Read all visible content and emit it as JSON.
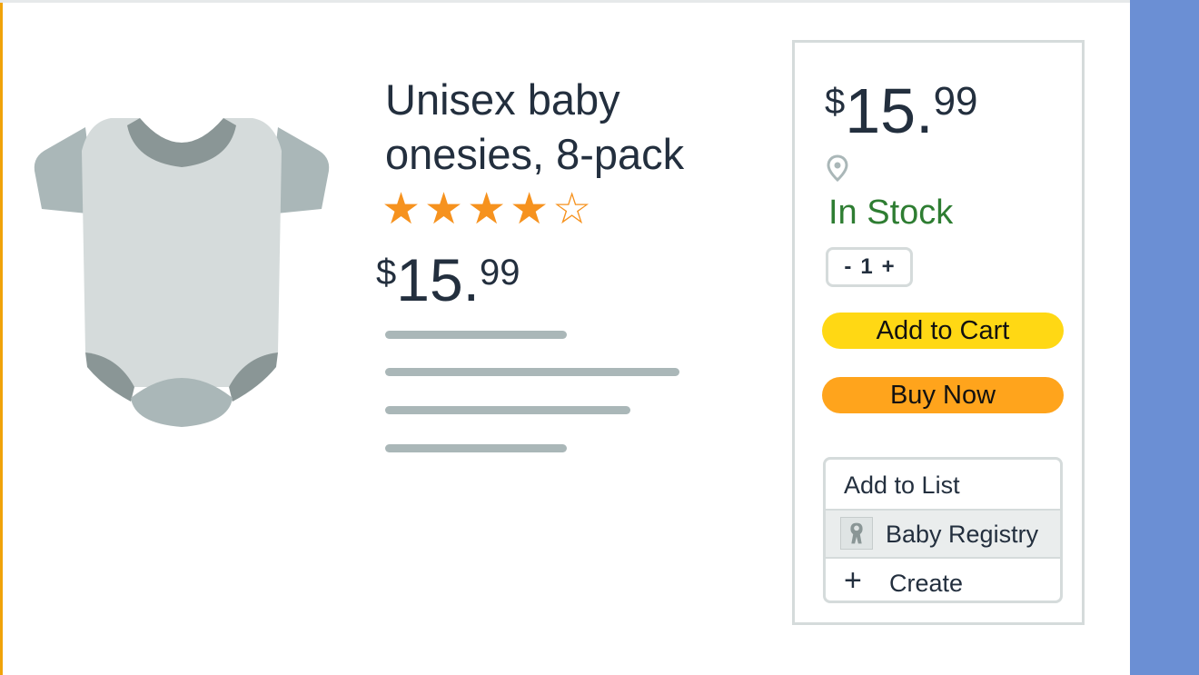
{
  "product": {
    "title_line1": "Unisex baby",
    "title_line2": "onesies, 8-pack",
    "rating": {
      "filled": 4,
      "total": 5
    },
    "price": {
      "currency": "$",
      "whole": "15.",
      "fraction": "99"
    },
    "image_icon": "baby-onesie-icon"
  },
  "buy_box": {
    "price": {
      "currency": "$",
      "whole": "15.",
      "fraction": "99"
    },
    "location_icon": "map-pin-icon",
    "stock_status": "In Stock",
    "quantity": {
      "minus": "-",
      "value": "1",
      "plus": "+"
    },
    "add_to_cart": "Add to Cart",
    "buy_now": "Buy Now",
    "list_menu": {
      "header": "Add to List",
      "registry_label": "Baby Registry",
      "create_label": "Create",
      "create_icon": "+"
    }
  },
  "colors": {
    "accent_orange": "#ffa41c",
    "cart_yellow": "#ffd814",
    "stock_green": "#2e7d32",
    "star_orange": "#f6921e",
    "side_band_blue": "#6b8fd4"
  }
}
